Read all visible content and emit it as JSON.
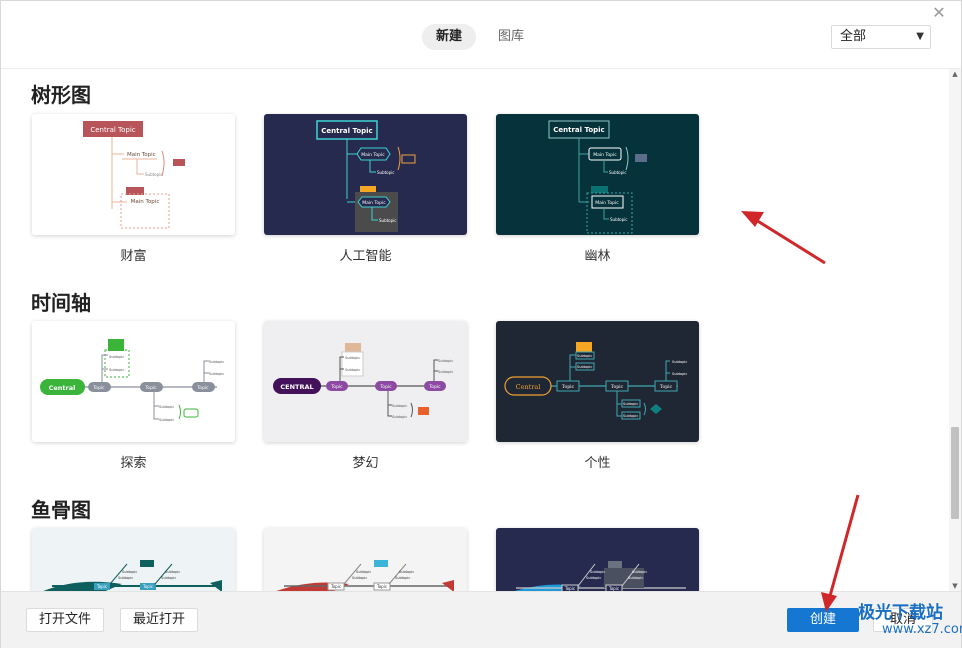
{
  "header": {
    "tabs": [
      {
        "label": "新建",
        "active": true
      },
      {
        "label": "图库",
        "active": false
      }
    ],
    "filter": {
      "value": "全部"
    },
    "close_icon": "close-icon"
  },
  "sections": [
    {
      "title": "树形图",
      "templates": [
        {
          "label": "财富",
          "thumb_bg": "#ffffff",
          "theme": "light-red",
          "texts": [
            "Central Topic",
            "Main Topic",
            "Subtopic",
            "Main Topic"
          ]
        },
        {
          "label": "人工智能",
          "thumb_bg": "#262a4e",
          "theme": "ai",
          "texts": [
            "Central Topic",
            "Main Topic",
            "Subtopic",
            "Main Topic",
            "Subtopic"
          ]
        },
        {
          "label": "幽林",
          "thumb_bg": "#06333b",
          "theme": "forest",
          "texts": [
            "Central Topic",
            "Main Topic",
            "Subtopic",
            "Main Topic",
            "Subtopic"
          ]
        }
      ]
    },
    {
      "title": "时间轴",
      "templates": [
        {
          "label": "探索",
          "thumb_bg": "#ffffff",
          "theme": "explore",
          "texts": [
            "Central",
            "Topic",
            "Topic",
            "Topic",
            "Subtopic",
            "Subtopic",
            "Subtopic",
            "Subtopic",
            "Subtopic",
            "Subtopic"
          ]
        },
        {
          "label": "梦幻",
          "thumb_bg": "#efeff2",
          "theme": "dream",
          "texts": [
            "CENTRAL",
            "Topic",
            "Topic",
            "Topic",
            "Subtopic",
            "Subtopic",
            "Subtopic",
            "Subtopic",
            "Subtopic",
            "Subtopic"
          ]
        },
        {
          "label": "个性",
          "thumb_bg": "#1f2634",
          "theme": "personal",
          "texts": [
            "Central",
            "Topic",
            "Topic",
            "Topic",
            "Subtopic",
            "Subtopic",
            "Subtopic",
            "Subtopic",
            "Subtopic",
            "Subtopic"
          ]
        }
      ]
    },
    {
      "title": "鱼骨图",
      "templates": [
        {
          "label": "",
          "thumb_bg": "#eef4f5",
          "theme": "fish-teal",
          "texts": [
            "Topic",
            "Topic",
            "Subtopic",
            "Subtopic",
            "Subtopic",
            "Subtopic"
          ]
        },
        {
          "label": "",
          "thumb_bg": "#f4f4f4",
          "theme": "fish-red",
          "texts": [
            "Topic",
            "Topic",
            "Subtopic",
            "Subtopic",
            "Subtopic",
            "Subtopic"
          ]
        },
        {
          "label": "",
          "thumb_bg": "#262a4e",
          "theme": "fish-dark",
          "texts": [
            "Topic",
            "Topic",
            "Subtopic",
            "Subtopic",
            "Subtopic",
            "Subtopic"
          ]
        }
      ]
    }
  ],
  "footer": {
    "open_file": "打开文件",
    "recent_open": "最近打开",
    "create": "创建",
    "cancel": "取消"
  },
  "watermark": {
    "line1": "极光下载站",
    "line2": "www.xz7.com"
  },
  "colors": {
    "primary": "#1677d2",
    "arrow": "#d0282a"
  }
}
